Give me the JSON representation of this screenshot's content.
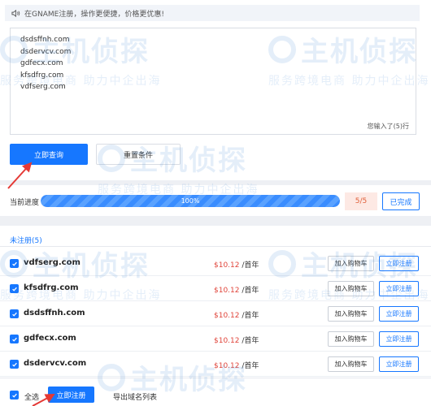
{
  "notice": {
    "text": "在GNAME注册，操作更便捷，价格更优惠!"
  },
  "query": {
    "lines": [
      "dsdsffnh.com",
      "dsdervcv.com",
      "gdfecx.com",
      "kfsdfrg.com",
      "vdfserg.com"
    ],
    "counter": "您输入了(5)行"
  },
  "buttons": {
    "query": "立即查询",
    "reset": "重置条件"
  },
  "progress": {
    "label": "当前进度",
    "percent": 100,
    "percent_text": "100%",
    "count": "5/5",
    "done": "已完成"
  },
  "list": {
    "title": "未注册(5)",
    "rows": [
      {
        "domain": "vdfserg.com",
        "price": "$10.12",
        "unit": "/首年",
        "cart": "加入购物车",
        "register": "立即注册"
      },
      {
        "domain": "kfsdfrg.com",
        "price": "$10.12",
        "unit": "/首年",
        "cart": "加入购物车",
        "register": "立即注册"
      },
      {
        "domain": "dsdsffnh.com",
        "price": "$10.12",
        "unit": "/首年",
        "cart": "加入购物车",
        "register": "立即注册"
      },
      {
        "domain": "gdfecx.com",
        "price": "$10.12",
        "unit": "/首年",
        "cart": "加入购物车",
        "register": "立即注册"
      },
      {
        "domain": "dsdervcv.com",
        "price": "$10.12",
        "unit": "/首年",
        "cart": "加入购物车",
        "register": "立即注册"
      }
    ]
  },
  "footer": {
    "select_all": "全选",
    "register_now": "立即注册",
    "export": "导出域名列表"
  },
  "watermark": {
    "logo": "主机侦探",
    "slogan": "服务跨境电商 助力中企出海"
  },
  "colors": {
    "primary": "#1677ff",
    "price": "#e0443a",
    "count_bg": "#fde9e4",
    "count_text": "#e0603a",
    "arrow": "#e53935"
  },
  "icons": {
    "notice": "speaker-icon",
    "checkbox": "check-icon"
  }
}
